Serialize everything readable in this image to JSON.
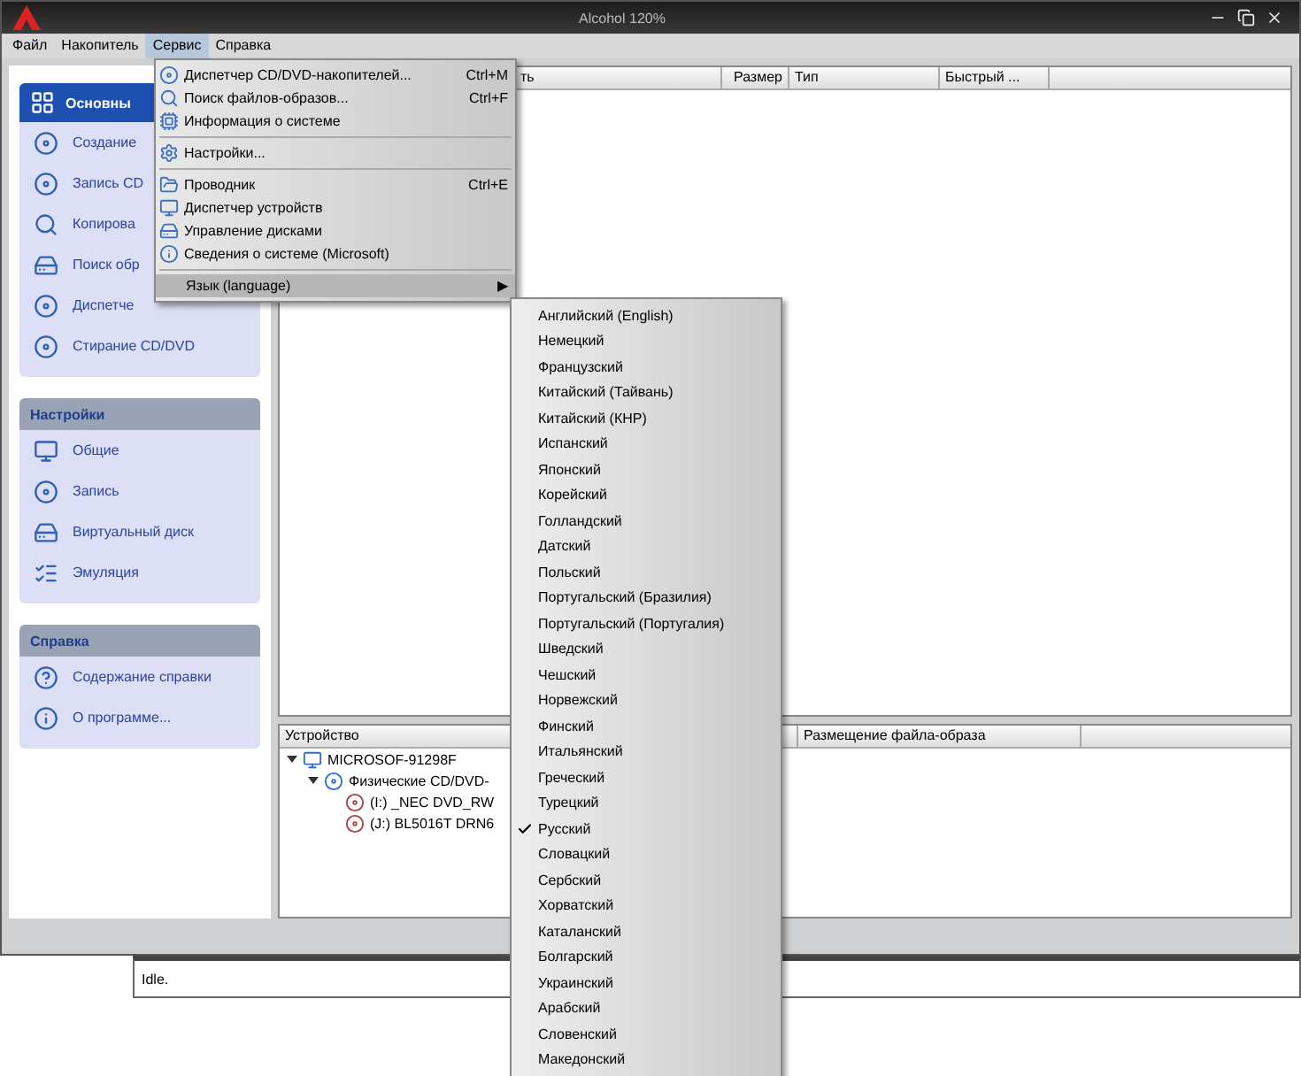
{
  "window": {
    "title": "Alcohol 120%"
  },
  "menu_bar": [
    {
      "label": "Файл",
      "selected": false
    },
    {
      "label": "Накопитель",
      "selected": false
    },
    {
      "label": "Сервис",
      "selected": true
    },
    {
      "label": "Справка",
      "selected": false
    }
  ],
  "sidebar": [
    {
      "title": "Основны",
      "highlighted": true,
      "items": [
        "Создание",
        "Запись CD",
        "Копирова",
        "Поиск обр",
        "Диспетче",
        "Стирание CD/DVD"
      ]
    },
    {
      "title": "Настройки",
      "highlighted": false,
      "items": [
        "Общие",
        "Запись",
        "Виртуальный диск",
        "Эмуляция"
      ]
    },
    {
      "title": "Справка",
      "highlighted": false,
      "items": [
        "Содержание справки",
        "О программе..."
      ]
    }
  ],
  "file_table": {
    "columns": [
      "ть",
      "Размер",
      "Тип",
      "Быстрый ..."
    ]
  },
  "device_table": {
    "columns": [
      "Устройство",
      "Размещение файла-образа"
    ],
    "tree": [
      {
        "label": "MICROSOF-91298F",
        "expanded": true,
        "children": [
          {
            "label": "Физические CD/DVD-",
            "expanded": true,
            "children": [
              {
                "label": "(I:) _NEC DVD_RW"
              },
              {
                "label": "(J:) BL5016T DRN6"
              }
            ]
          }
        ]
      }
    ]
  },
  "status_bar": "Idle.",
  "service_menu": [
    {
      "kind": "item",
      "label": "Диспетчер CD/DVD-накопителей...",
      "shortcut": "Ctrl+M"
    },
    {
      "kind": "item",
      "label": "Поиск файлов-образов...",
      "shortcut": "Ctrl+F"
    },
    {
      "kind": "item",
      "label": "Информация о системе"
    },
    {
      "kind": "separator"
    },
    {
      "kind": "item",
      "label": "Настройки..."
    },
    {
      "kind": "separator"
    },
    {
      "kind": "item",
      "label": "Проводник",
      "shortcut": "Ctrl+E"
    },
    {
      "kind": "item",
      "label": "Диспетчер устройств"
    },
    {
      "kind": "item",
      "label": "Управление дисками"
    },
    {
      "kind": "item",
      "label": "Сведения о системе (Microsoft)"
    },
    {
      "kind": "separator"
    },
    {
      "kind": "submenu",
      "label": "Язык (language)",
      "selected": true,
      "arrow": "▶"
    }
  ],
  "language_menu": [
    {
      "label": "Английский (English)",
      "checked": false
    },
    {
      "label": "Немецкий",
      "checked": false
    },
    {
      "label": "Французский",
      "checked": false
    },
    {
      "label": "Китайский (Тайвань)",
      "checked": false
    },
    {
      "label": "Китайский (КНР)",
      "checked": false
    },
    {
      "label": "Испанский",
      "checked": false
    },
    {
      "label": "Японский",
      "checked": false
    },
    {
      "label": "Корейский",
      "checked": false
    },
    {
      "label": "Голландский",
      "checked": false
    },
    {
      "label": "Датский",
      "checked": false
    },
    {
      "label": "Польский",
      "checked": false
    },
    {
      "label": "Португальский (Бразилия)",
      "checked": false
    },
    {
      "label": "Португальский (Португалия)",
      "checked": false
    },
    {
      "label": "Шведский",
      "checked": false
    },
    {
      "label": "Чешский",
      "checked": false
    },
    {
      "label": "Норвежский",
      "checked": false
    },
    {
      "label": "Финский",
      "checked": false
    },
    {
      "label": "Итальянский",
      "checked": false
    },
    {
      "label": "Греческий",
      "checked": false
    },
    {
      "label": "Турецкий",
      "checked": false
    },
    {
      "label": "Русский",
      "checked": true
    },
    {
      "label": "Словацкий",
      "checked": false
    },
    {
      "label": "Сербский",
      "checked": false
    },
    {
      "label": "Хорватский",
      "checked": false
    },
    {
      "label": "Каталанский",
      "checked": false
    },
    {
      "label": "Болгарский",
      "checked": false
    },
    {
      "label": "Украинский",
      "checked": false
    },
    {
      "label": "Арабский",
      "checked": false
    },
    {
      "label": "Словенский",
      "checked": false
    },
    {
      "label": "Македонский",
      "checked": false
    }
  ]
}
